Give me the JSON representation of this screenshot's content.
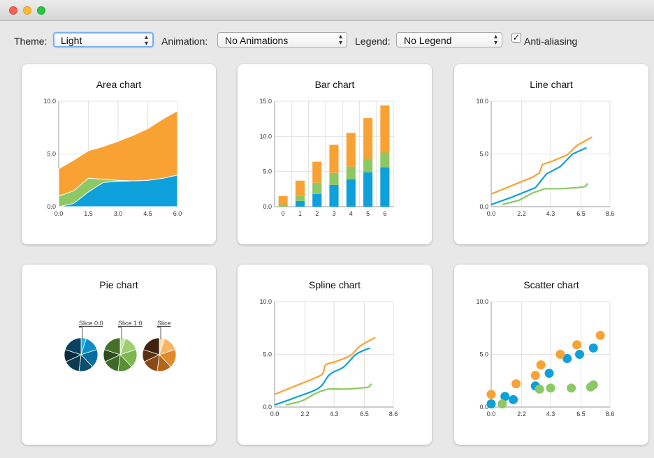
{
  "window": {
    "controls": [
      "close",
      "minimize",
      "zoom"
    ]
  },
  "toolbar": {
    "theme_label": "Theme:",
    "theme_value": "Light",
    "animation_label": "Animation:",
    "animation_value": "No Animations",
    "legend_label": "Legend:",
    "legend_value": "No Legend",
    "antialias_label": "Anti-aliasing",
    "antialias_checked": true
  },
  "colors": {
    "blue": "#0ea0db",
    "green": "#8cc864",
    "orange": "#f9a234"
  },
  "charts": {
    "area": {
      "title": "Area chart"
    },
    "bar": {
      "title": "Bar chart"
    },
    "line": {
      "title": "Line chart"
    },
    "pie": {
      "title": "Pie chart"
    },
    "spline": {
      "title": "Spline chart"
    },
    "scatter": {
      "title": "Scatter chart"
    }
  },
  "chart_data": [
    {
      "type": "area",
      "title": "Area chart",
      "x": [
        0,
        0.75,
        1.5,
        2.25,
        3.0,
        3.75,
        4.5,
        5.25,
        6.0
      ],
      "series": [
        {
          "values": [
            0,
            0.3,
            1.4,
            2.3,
            2.4,
            2.45,
            2.5,
            2.7,
            3.0
          ]
        },
        {
          "values": [
            1.0,
            1.2,
            1.3,
            0.3,
            0.1,
            0.0,
            0.0,
            0.0,
            0.0
          ]
        },
        {
          "values": [
            2.6,
            2.9,
            2.6,
            3.1,
            3.7,
            4.3,
            4.9,
            5.6,
            6.1
          ]
        }
      ],
      "ylim": [
        0,
        10
      ],
      "xlim": [
        0,
        6
      ],
      "yticks": [
        "10.0",
        "5.0",
        "0.0"
      ],
      "xticks": [
        "0.0",
        "1.5",
        "3.0",
        "4.5",
        "6.0"
      ]
    },
    {
      "type": "bar",
      "title": "Bar chart",
      "categories": [
        "0",
        "1",
        "2",
        "3",
        "4",
        "5",
        "6"
      ],
      "series": [
        {
          "values": [
            0.0,
            0.8,
            1.8,
            3.1,
            3.9,
            4.9,
            5.6
          ]
        },
        {
          "values": [
            0.3,
            0.7,
            1.6,
            1.7,
            1.8,
            1.9,
            2.1
          ]
        },
        {
          "values": [
            1.2,
            2.2,
            3.0,
            4.0,
            4.8,
            5.8,
            6.7
          ]
        }
      ],
      "ylim": [
        0,
        15
      ],
      "yticks": [
        "15.0",
        "10.0",
        "5.0",
        "0.0"
      ]
    },
    {
      "type": "line",
      "title": "Line chart",
      "series": [
        {
          "points": [
            [
              0.0,
              0.2
            ],
            [
              1.5,
              0.9
            ],
            [
              3.2,
              1.8
            ],
            [
              4.0,
              3.1
            ],
            [
              5.0,
              3.8
            ],
            [
              5.9,
              5.0
            ],
            [
              6.9,
              5.6
            ]
          ]
        },
        {
          "points": [
            [
              0.8,
              0.2
            ],
            [
              2.0,
              0.6
            ],
            [
              3.0,
              1.3
            ],
            [
              3.9,
              1.7
            ],
            [
              5.0,
              1.7
            ],
            [
              6.2,
              1.8
            ],
            [
              6.8,
              1.9
            ],
            [
              7.0,
              2.2
            ]
          ]
        },
        {
          "points": [
            [
              0.0,
              1.2
            ],
            [
              1.5,
              2.0
            ],
            [
              3.0,
              2.8
            ],
            [
              3.5,
              3.2
            ],
            [
              3.7,
              4.0
            ],
            [
              4.4,
              4.3
            ],
            [
              5.5,
              4.9
            ],
            [
              6.2,
              5.8
            ],
            [
              7.3,
              6.6
            ]
          ]
        }
      ],
      "ylim": [
        0,
        10
      ],
      "xlim": [
        0,
        8.6
      ],
      "yticks": [
        "10.0",
        "5.0",
        "0.0"
      ],
      "xticks": [
        "0.0",
        "2.2",
        "4.3",
        "6.5",
        "8.6"
      ]
    },
    {
      "type": "pie",
      "title": "Pie chart",
      "slice_labels": [
        "Slice 0:0",
        "Slice 1:0",
        "Slice"
      ],
      "pies": [
        {
          "values": [
            5,
            15,
            18,
            14,
            16,
            12,
            20
          ],
          "colors": [
            "#1bb2e6",
            "#0a90c8",
            "#066e9c",
            "#0a4f70",
            "#0d3a52",
            "#0b2c40",
            "#094260"
          ]
        },
        {
          "values": [
            5,
            15,
            18,
            14,
            16,
            12,
            20
          ],
          "colors": [
            "#c6e5a9",
            "#9fd070",
            "#7cb84f",
            "#5a8f35",
            "#3f6a26",
            "#2c4c1b",
            "#46702a"
          ]
        },
        {
          "values": [
            5,
            15,
            18,
            14,
            16,
            12,
            20
          ],
          "colors": [
            "#fde0b8",
            "#f7b667",
            "#e08a2c",
            "#b5651b",
            "#8a4a16",
            "#5c3010",
            "#3f230c"
          ]
        }
      ]
    },
    {
      "type": "line",
      "title": "Spline chart",
      "series": [
        {
          "points": [
            [
              0.0,
              0.2
            ],
            [
              1.5,
              0.9
            ],
            [
              3.2,
              1.8
            ],
            [
              4.0,
              3.1
            ],
            [
              5.0,
              3.8
            ],
            [
              5.9,
              5.0
            ],
            [
              6.9,
              5.6
            ]
          ]
        },
        {
          "points": [
            [
              0.8,
              0.2
            ],
            [
              2.0,
              0.6
            ],
            [
              3.0,
              1.3
            ],
            [
              3.9,
              1.7
            ],
            [
              5.0,
              1.7
            ],
            [
              6.2,
              1.8
            ],
            [
              6.8,
              1.9
            ],
            [
              7.0,
              2.2
            ]
          ]
        },
        {
          "points": [
            [
              0.0,
              1.2
            ],
            [
              1.5,
              2.0
            ],
            [
              3.0,
              2.8
            ],
            [
              3.5,
              3.2
            ],
            [
              3.7,
              4.0
            ],
            [
              4.4,
              4.3
            ],
            [
              5.5,
              4.9
            ],
            [
              6.2,
              5.8
            ],
            [
              7.3,
              6.6
            ]
          ]
        }
      ],
      "ylim": [
        0,
        10
      ],
      "xlim": [
        0,
        8.6
      ],
      "yticks": [
        "10.0",
        "5.0",
        "0.0"
      ],
      "xticks": [
        "0.0",
        "2.2",
        "4.3",
        "6.5",
        "8.6"
      ]
    },
    {
      "type": "scatter",
      "title": "Scatter chart",
      "series": [
        {
          "points": [
            [
              0.0,
              0.3
            ],
            [
              1.0,
              1.0
            ],
            [
              1.6,
              0.7
            ],
            [
              3.2,
              2.0
            ],
            [
              4.2,
              3.2
            ],
            [
              5.5,
              4.6
            ],
            [
              6.4,
              5.0
            ],
            [
              7.4,
              5.6
            ]
          ]
        },
        {
          "points": [
            [
              0.8,
              0.3
            ],
            [
              3.5,
              1.7
            ],
            [
              4.3,
              1.8
            ],
            [
              5.8,
              1.8
            ],
            [
              7.2,
              1.9
            ],
            [
              7.4,
              2.1
            ]
          ]
        },
        {
          "points": [
            [
              0.0,
              1.2
            ],
            [
              1.8,
              2.2
            ],
            [
              3.2,
              3.0
            ],
            [
              3.6,
              4.0
            ],
            [
              5.0,
              5.0
            ],
            [
              6.2,
              5.9
            ],
            [
              7.9,
              6.8
            ]
          ]
        }
      ],
      "ylim": [
        0,
        10
      ],
      "xlim": [
        0,
        8.6
      ],
      "yticks": [
        "10.0",
        "5.0",
        "0.0"
      ],
      "xticks": [
        "0.0",
        "2.2",
        "4.3",
        "6.5",
        "8.6"
      ]
    }
  ]
}
